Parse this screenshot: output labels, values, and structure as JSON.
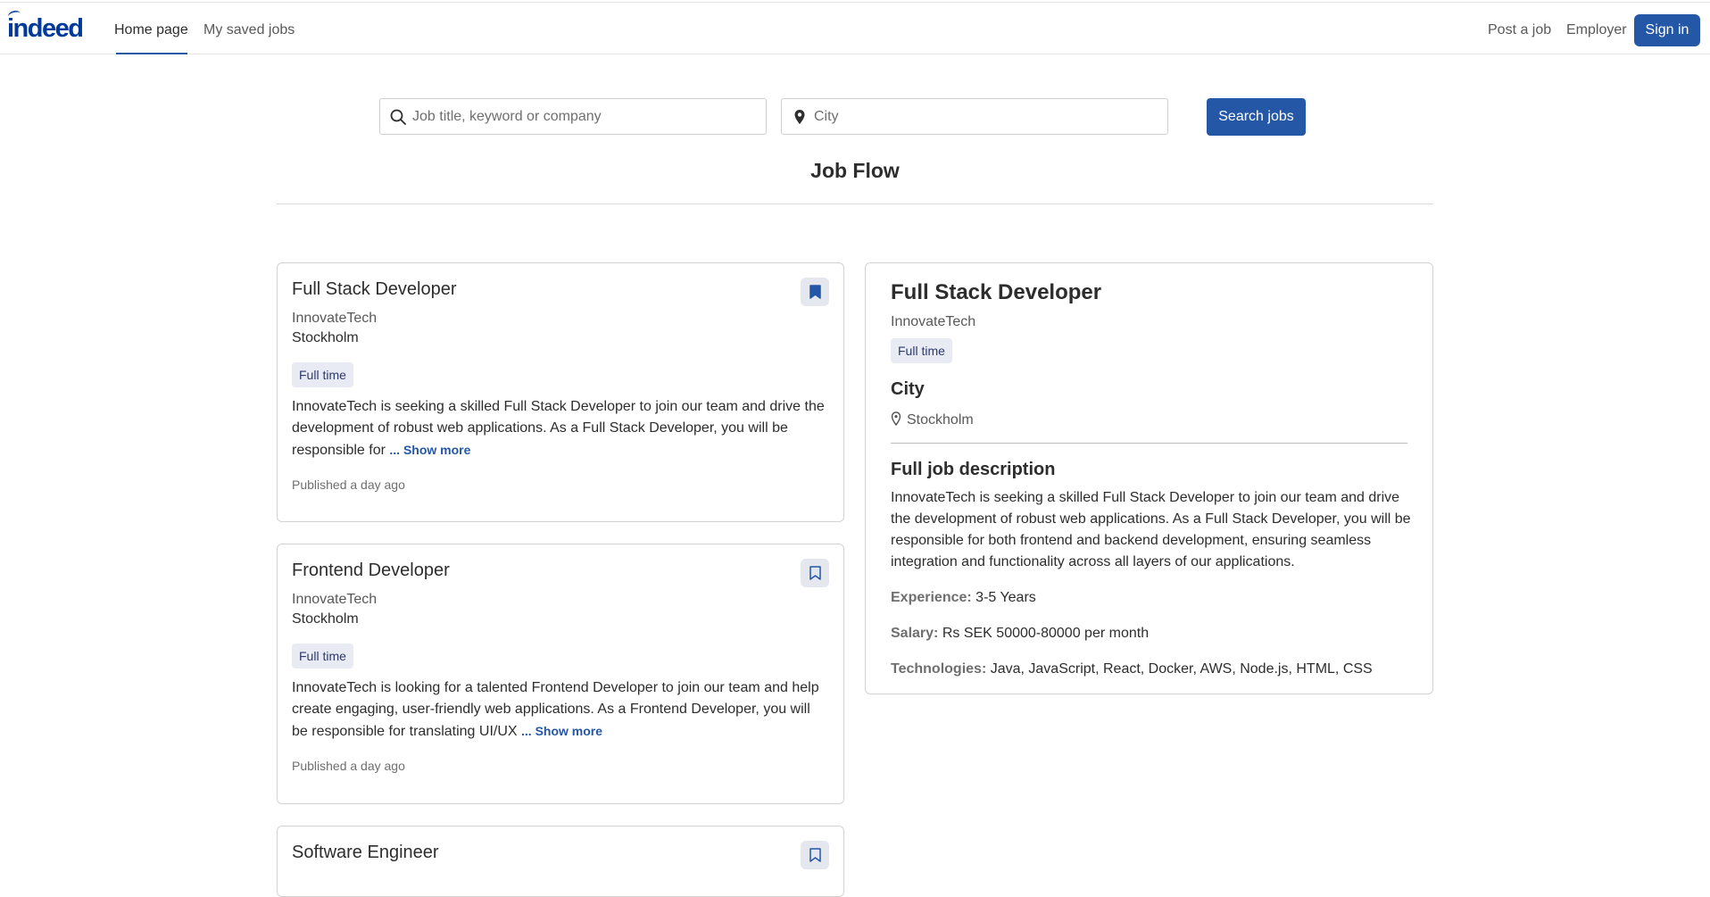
{
  "nav": {
    "logo": "indeed",
    "home": "Home page",
    "saved": "My saved jobs",
    "post_job": "Post a job",
    "employer": "Employer",
    "sign_in": "Sign in"
  },
  "search": {
    "keyword_placeholder": "Job title, keyword or company",
    "city_placeholder": "City",
    "button": "Search jobs"
  },
  "page_title": "Job Flow",
  "jobs": [
    {
      "title": "Full Stack Developer",
      "company": "InnovateTech",
      "city": "Stockholm",
      "type": "Full time",
      "snippet": "InnovateTech is seeking a skilled Full Stack Developer to join our team and drive the development of robust web applications. As a Full Stack Developer, you will be responsible for",
      "show_more": "... Show more",
      "published": "Published a day ago",
      "saved": true
    },
    {
      "title": "Frontend Developer",
      "company": "InnovateTech",
      "city": "Stockholm",
      "type": "Full time",
      "snippet": "InnovateTech is looking for a talented Frontend Developer to join our team and help create engaging, user-friendly web applications. As a Frontend Developer, you will be responsible for translating UI/UX",
      "show_more": "... Show more",
      "published": "Published a day ago",
      "saved": false
    },
    {
      "title": "Software Engineer",
      "saved": false
    }
  ],
  "detail": {
    "title": "Full Stack Developer",
    "company": "InnovateTech",
    "type": "Full time",
    "city_heading": "City",
    "city": "Stockholm",
    "desc_heading": "Full job description",
    "description": "InnovateTech is seeking a skilled Full Stack Developer to join our team and drive the development of robust web applications. As a Full Stack Developer, you will be responsible for both frontend and backend development, ensuring seamless integration and functionality across all layers of our applications.",
    "experience_label": "Experience:",
    "experience": "3-5 Years",
    "salary_label": "Salary:",
    "salary": "Rs SEK 50000-80000 per month",
    "tech_label": "Technologies:",
    "technologies": "Java, JavaScript, React, Docker, AWS, Node.js, HTML, CSS"
  },
  "colors": {
    "brand": "#003a9b",
    "accent": "#2557a7",
    "tag_bg": "#e8ebf4"
  }
}
